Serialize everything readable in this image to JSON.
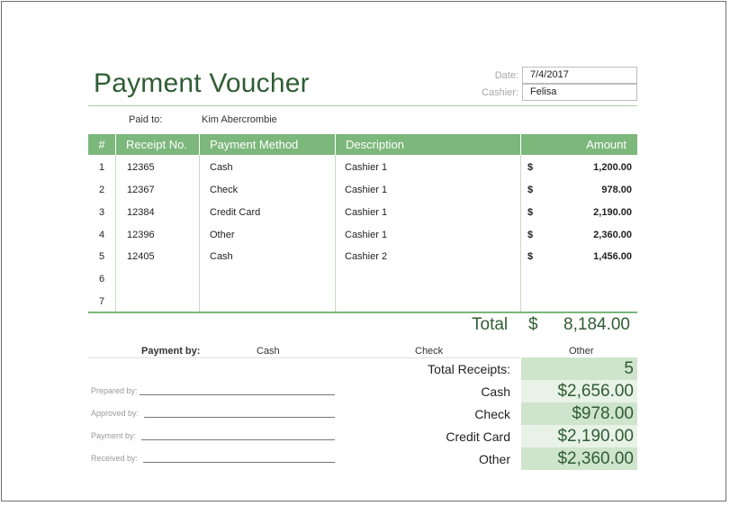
{
  "title": "Payment Voucher",
  "meta": {
    "date_label": "Date:",
    "date_value": "7/4/2017",
    "cashier_label": "Cashier:",
    "cashier_value": "Felisa"
  },
  "paid_to": {
    "label": "Paid to:",
    "value": "Kim Abercrombie"
  },
  "table": {
    "headers": [
      "#",
      "Receipt No.",
      "Payment Method",
      "Description",
      "Amount"
    ],
    "rows": [
      {
        "num": "1",
        "receipt": "12365",
        "method": "Cash",
        "desc": "Cashier 1",
        "dollar": "$",
        "amount": "1,200.00"
      },
      {
        "num": "2",
        "receipt": "12367",
        "method": "Check",
        "desc": "Cashier 1",
        "dollar": "$",
        "amount": "978.00"
      },
      {
        "num": "3",
        "receipt": "12384",
        "method": "Credit Card",
        "desc": "Cashier 1",
        "dollar": "$",
        "amount": "2,190.00"
      },
      {
        "num": "4",
        "receipt": "12396",
        "method": "Other",
        "desc": "Cashier 1",
        "dollar": "$",
        "amount": "2,360.00"
      },
      {
        "num": "5",
        "receipt": "12405",
        "method": "Cash",
        "desc": "Cashier 2",
        "dollar": "$",
        "amount": "1,456.00"
      },
      {
        "num": "6",
        "receipt": "",
        "method": "",
        "desc": "",
        "dollar": "",
        "amount": ""
      },
      {
        "num": "7",
        "receipt": "",
        "method": "",
        "desc": "",
        "dollar": "",
        "amount": ""
      }
    ]
  },
  "total": {
    "label": "Total",
    "dollar": "$",
    "value": "8,184.00"
  },
  "payment_by": {
    "label": "Payment by:",
    "options": [
      "Cash",
      "Check",
      "Other"
    ]
  },
  "signatures": [
    "Prepared by:",
    "Approved by:",
    "Payment by:",
    "Received by:"
  ],
  "summary": [
    {
      "label": "Total Receipts:",
      "value": "5"
    },
    {
      "label": "Cash",
      "value": "$2,656.00"
    },
    {
      "label": "Check",
      "value": "$978.00"
    },
    {
      "label": "Credit Card",
      "value": "$2,190.00"
    },
    {
      "label": "Other",
      "value": "$2,360.00"
    }
  ],
  "colors": {
    "header_green": "#7cb77b",
    "title_green": "#2f5d33",
    "summary_dark": "#cfe4cd",
    "summary_light": "#e8f2e7"
  }
}
